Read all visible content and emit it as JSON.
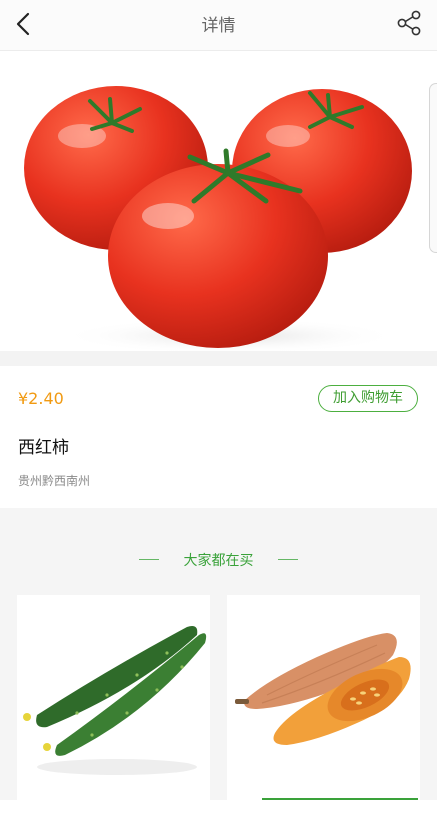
{
  "header": {
    "title": "详情",
    "back_icon": "back-arrow-icon",
    "share_icon": "share-icon"
  },
  "product": {
    "image": "tomato",
    "price": "¥2.40",
    "add_to_cart_label": "加入购物车",
    "name": "西红柿",
    "origin": "贵州黔西南州"
  },
  "recommendations": {
    "title": "大家都在买",
    "items": [
      {
        "image": "cucumber"
      },
      {
        "image": "pumpkin"
      }
    ]
  },
  "colors": {
    "price": "#f19a12",
    "accent_green": "#3aa23a",
    "page_gray": "#f5f5f5"
  }
}
